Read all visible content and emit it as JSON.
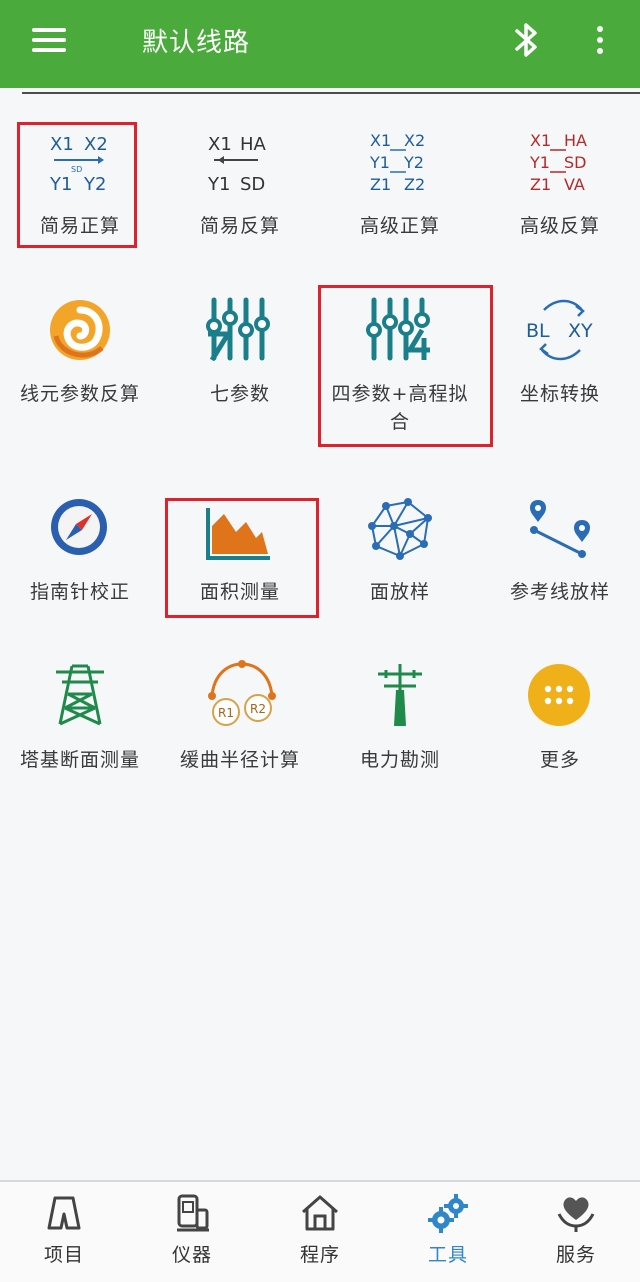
{
  "header": {
    "title": "默认线路",
    "menu_icon": "menu-icon",
    "bluetooth_icon": "bluetooth-icon",
    "more_icon": "more-vertical-icon"
  },
  "tools": [
    {
      "label": "简易正算",
      "icon": "simple-forward-calc-icon",
      "glyphs": [
        "X1",
        "X2",
        "Y1",
        "Y2",
        "SD"
      ]
    },
    {
      "label": "简易反算",
      "icon": "simple-inverse-calc-icon",
      "glyphs": [
        "X1",
        "HA",
        "Y1",
        "SD"
      ]
    },
    {
      "label": "高级正算",
      "icon": "advanced-forward-calc-icon",
      "glyphs": [
        "X1",
        "X2",
        "Y1",
        "Y2",
        "Z1",
        "Z2"
      ]
    },
    {
      "label": "高级反算",
      "icon": "advanced-inverse-calc-icon",
      "glyphs": [
        "X1",
        "HA",
        "Y1",
        "SD",
        "Z1",
        "VA"
      ]
    },
    {
      "label": "线元参数反算",
      "icon": "spiral-icon"
    },
    {
      "label": "七参数",
      "icon": "seven-params-icon"
    },
    {
      "label": "四参数+高程拟合",
      "icon": "four-params-height-fit-icon"
    },
    {
      "label": "坐标转换",
      "icon": "coordinate-transform-icon",
      "glyphs": [
        "BL",
        "XY"
      ]
    },
    {
      "label": "指南针校正",
      "icon": "compass-icon"
    },
    {
      "label": "面积测量",
      "icon": "area-chart-icon"
    },
    {
      "label": "面放样",
      "icon": "surface-stakeout-icon"
    },
    {
      "label": "参考线放样",
      "icon": "reference-line-stakeout-icon"
    },
    {
      "label": "塔基断面测量",
      "icon": "power-tower-icon"
    },
    {
      "label": "缓曲半径计算",
      "icon": "curve-radius-icon",
      "glyphs": [
        "R1",
        "R2"
      ]
    },
    {
      "label": "电力勘测",
      "icon": "power-pole-icon"
    },
    {
      "label": "更多",
      "icon": "more-apps-icon"
    }
  ],
  "tabs": [
    {
      "label": "项目",
      "icon": "project-icon"
    },
    {
      "label": "仪器",
      "icon": "instrument-icon"
    },
    {
      "label": "程序",
      "icon": "home-icon"
    },
    {
      "label": "工具",
      "icon": "gears-icon",
      "active": true
    },
    {
      "label": "服务",
      "icon": "service-icon"
    }
  ],
  "colors": {
    "header_bg": "#4aab3c",
    "teal_icon": "#1a7f8a",
    "blue_icon": "#2a6db5",
    "orange_icon": "#e0741a",
    "red_label": "#b42a2a",
    "highlight_box": "#e0202a",
    "active_tab": "#2f86c9",
    "more_button": "#f0b01a"
  }
}
